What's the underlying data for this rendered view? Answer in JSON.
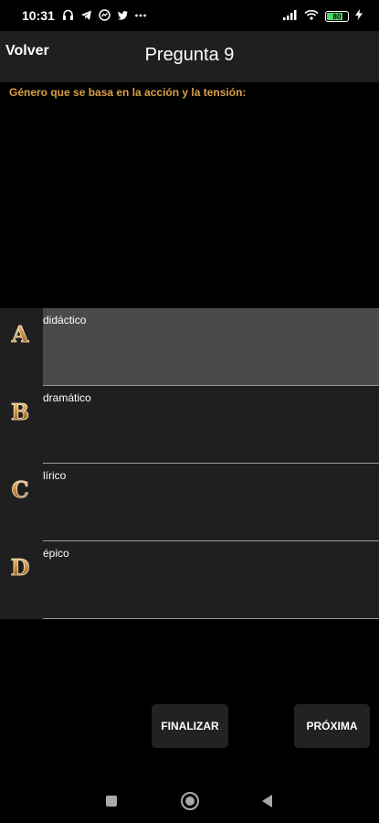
{
  "status_bar": {
    "time": "10:31",
    "icons": [
      "headphones-icon",
      "telegram-icon",
      "messenger-icon",
      "twitter-icon",
      "more-icon"
    ],
    "battery_level": "80",
    "battery_color": "#4cd964"
  },
  "header": {
    "back_label": "Volver",
    "title": "Pregunta 9"
  },
  "question": {
    "text": "Género que se basa en la acción y la tensión:",
    "color": "#d9a04a"
  },
  "options": [
    {
      "letter": "A",
      "label": "didáctico",
      "selected": true
    },
    {
      "letter": "B",
      "label": "dramático",
      "selected": false
    },
    {
      "letter": "C",
      "label": "lírico",
      "selected": false
    },
    {
      "letter": "D",
      "label": "épico",
      "selected": false
    }
  ],
  "buttons": {
    "finish_label": "FINALIZAR",
    "next_label": "PRÓXIMA"
  },
  "nav_bar": {
    "icons": [
      "recents-icon",
      "home-icon",
      "back-icon"
    ]
  }
}
